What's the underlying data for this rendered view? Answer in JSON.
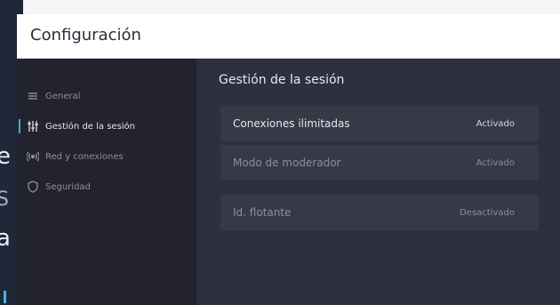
{
  "window": {
    "title": "Configuración"
  },
  "background_fragments": [
    "e",
    "S",
    "a"
  ],
  "sidebar": {
    "items": [
      {
        "label": "General",
        "icon": "list-icon",
        "active": false
      },
      {
        "label": "Gestión de la sesión",
        "icon": "sliders-icon",
        "active": true
      },
      {
        "label": "Red y conexiones",
        "icon": "broadcast-icon",
        "active": false
      },
      {
        "label": "Seguridad",
        "icon": "shield-icon",
        "active": false
      }
    ]
  },
  "main": {
    "section_title": "Gestión de la sesión",
    "settings": [
      {
        "label": "Conexiones ilimitadas",
        "value": "Activado"
      },
      {
        "label": "Modo de moderador",
        "value": "Activado"
      },
      {
        "label": "Id. flotante",
        "value": "Desactivado"
      }
    ]
  },
  "colors": {
    "accent": "#3bb1d6",
    "window_bg": "#2e303e",
    "sidebar_bg": "#22232e",
    "row_bg": "#373947"
  }
}
